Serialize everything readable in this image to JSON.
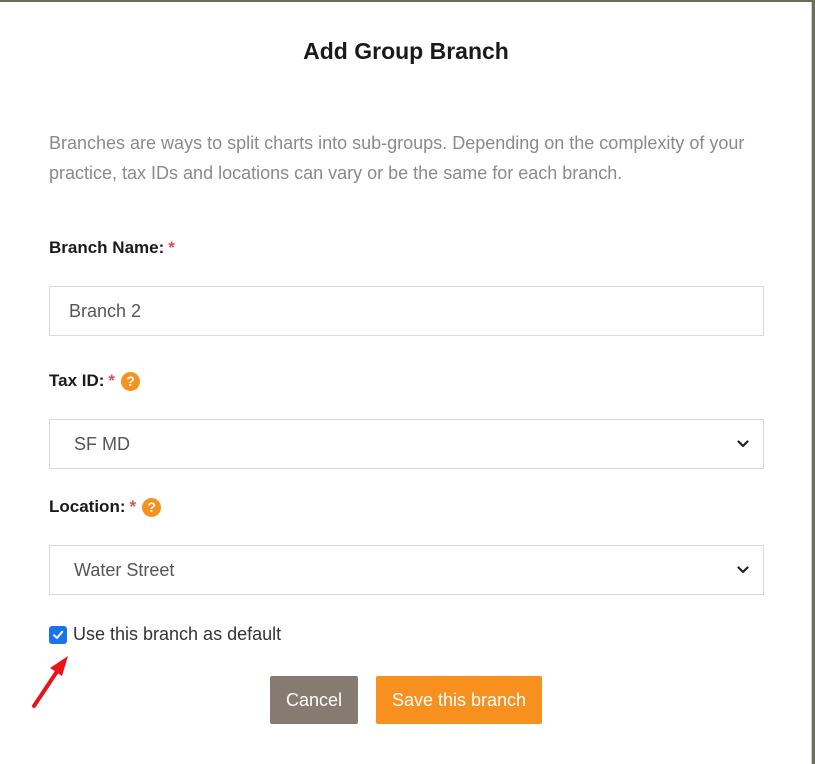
{
  "dialog": {
    "title": "Add Group Branch",
    "description": "Branches are ways to split charts into sub-groups. Depending on the complexity of your practice, tax IDs and locations can vary or be the same for each branch."
  },
  "branch_name": {
    "label": "Branch Name:",
    "required_mark": "*",
    "value": "Branch 2"
  },
  "tax_id": {
    "label": "Tax ID:",
    "required_mark": "*",
    "help_glyph": "?",
    "selected": "SF MD"
  },
  "location": {
    "label": "Location:",
    "required_mark": "*",
    "help_glyph": "?",
    "selected": "Water Street"
  },
  "default_checkbox": {
    "label": "Use this branch as default",
    "checked": true
  },
  "buttons": {
    "cancel": "Cancel",
    "save": "Save this branch"
  },
  "colors": {
    "accent": "#f7901e",
    "cancel": "#857b70",
    "checkbox": "#1a73e8",
    "required": "#d9534f",
    "annotation_arrow": "#e8131b"
  }
}
